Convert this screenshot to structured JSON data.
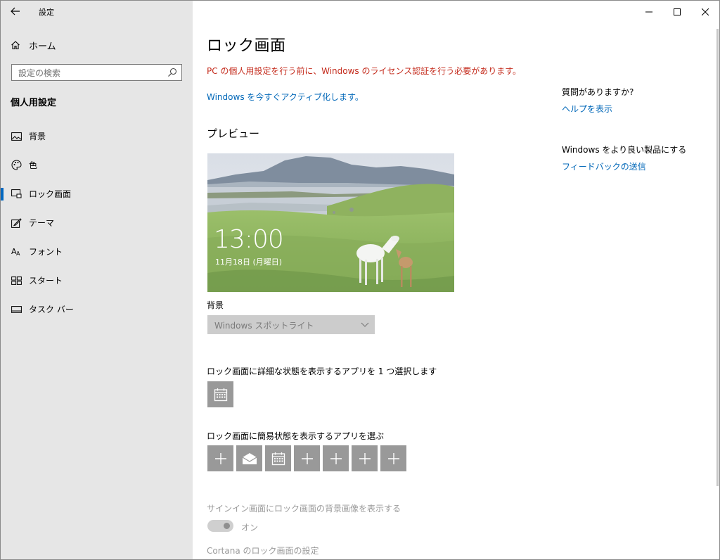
{
  "window": {
    "title": "設定",
    "controls": {
      "minimize": "—",
      "maximize": "☐",
      "close": "✕"
    }
  },
  "sidebar": {
    "home_label": "ホーム",
    "search_placeholder": "設定の検索",
    "section_heading": "個人用設定",
    "items": [
      {
        "label": "背景",
        "icon": "picture-icon"
      },
      {
        "label": "色",
        "icon": "palette-icon"
      },
      {
        "label": "ロック画面",
        "icon": "lock-screen-icon",
        "active": true
      },
      {
        "label": "テーマ",
        "icon": "theme-icon"
      },
      {
        "label": "フォント",
        "icon": "font-icon"
      },
      {
        "label": "スタート",
        "icon": "start-icon"
      },
      {
        "label": "タスク バー",
        "icon": "taskbar-icon"
      }
    ]
  },
  "main": {
    "title": "ロック画面",
    "warning": "PC の個人用設定を行う前に、Windows のライセンス認証を行う必要があります。",
    "activate_link": "Windows を今すぐアクティブ化します。",
    "preview_heading": "プレビュー",
    "preview": {
      "time": "13:00",
      "date": "11月18日 (月曜日)"
    },
    "background_label": "背景",
    "background_value": "Windows スポットライト",
    "detailed_status_label": "ロック画面に詳細な状態を表示するアプリを 1 つ選択します",
    "detailed_status_apps": [
      "calendar-icon"
    ],
    "quick_status_label": "ロック画面に簡易状態を表示するアプリを選ぶ",
    "quick_status_apps": [
      "plus-icon",
      "mail-icon",
      "calendar-icon",
      "plus-icon",
      "plus-icon",
      "plus-icon",
      "plus-icon"
    ],
    "signin_label": "サインイン画面にロック画面の背景画像を表示する",
    "signin_toggle": "オン",
    "cortana_label": "Cortana のロック画面の設定"
  },
  "aside": {
    "question": "質問がありますか?",
    "help_link": "ヘルプを表示",
    "improve": "Windows をより良い製品にする",
    "feedback_link": "フィードバックの送信"
  },
  "colors": {
    "accent": "#0067b8",
    "warning": "#c42b1c",
    "sidebar_bg": "#e6e6e6",
    "tile_bg": "#999999"
  }
}
